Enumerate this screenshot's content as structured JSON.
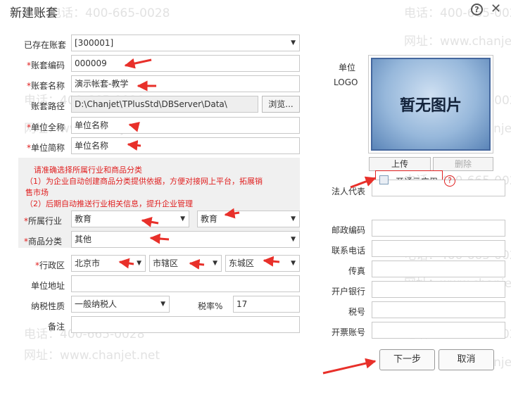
{
  "window": {
    "title": "新建账套"
  },
  "watermark": {
    "phone": "电话：400-665-0028",
    "site": "网址：www.chanjet.net"
  },
  "form": {
    "existing_label": "已存在账套",
    "existing_value": "[300001]",
    "code_label": "账套编码",
    "code_value": "000009",
    "name_label": "账套名称",
    "name_value": "演示帐套-教学",
    "path_label": "账套路径",
    "path_value": "D:\\Chanjet\\TPlusStd\\DBServer\\Data\\",
    "browse_label": "浏览...",
    "fullname_label": "单位全称",
    "fullname_value": "单位名称",
    "shortname_label": "单位简称",
    "shortname_value": "单位名称",
    "notice_line1": "请准确选择所属行业和商品分类",
    "notice_line2": "（1）为企业自动创建商品分类提供依据，方便对接网上平台，拓展销",
    "notice_line3": "售市场",
    "notice_line4": "（2）后期自动推送行业相关信息，提升企业管理",
    "industry_label": "所属行业",
    "industry_value1": "教育",
    "industry_value2": "教育",
    "category_label": "商品分类",
    "category_value": "其他",
    "region_label": "行政区",
    "region_province": "北京市",
    "region_city": "市辖区",
    "region_district": "东城区",
    "address_label": "单位地址",
    "address_value": "",
    "tax_type_label": "纳税性质",
    "tax_type_value": "一般纳税人",
    "tax_rate_label": "税率%",
    "tax_rate_value": "17",
    "remark_label": "备注",
    "remark_value": ""
  },
  "logo": {
    "label_line1": "单位",
    "label_line2": "LOGO",
    "placeholder": "暂无图片",
    "upload_label": "上传",
    "delete_label": "删除"
  },
  "cloud": {
    "label": "开通云应用",
    "checked": false,
    "help": "?"
  },
  "right_fields": {
    "legal_rep_label": "法人代表",
    "postcode_label": "邮政编码",
    "phone_label": "联系电话",
    "fax_label": "传真",
    "bank_label": "开户银行",
    "tax_no_label": "税号",
    "invoice_acct_label": "开票账号"
  },
  "footer": {
    "next_label": "下一步",
    "cancel_label": "取消"
  }
}
